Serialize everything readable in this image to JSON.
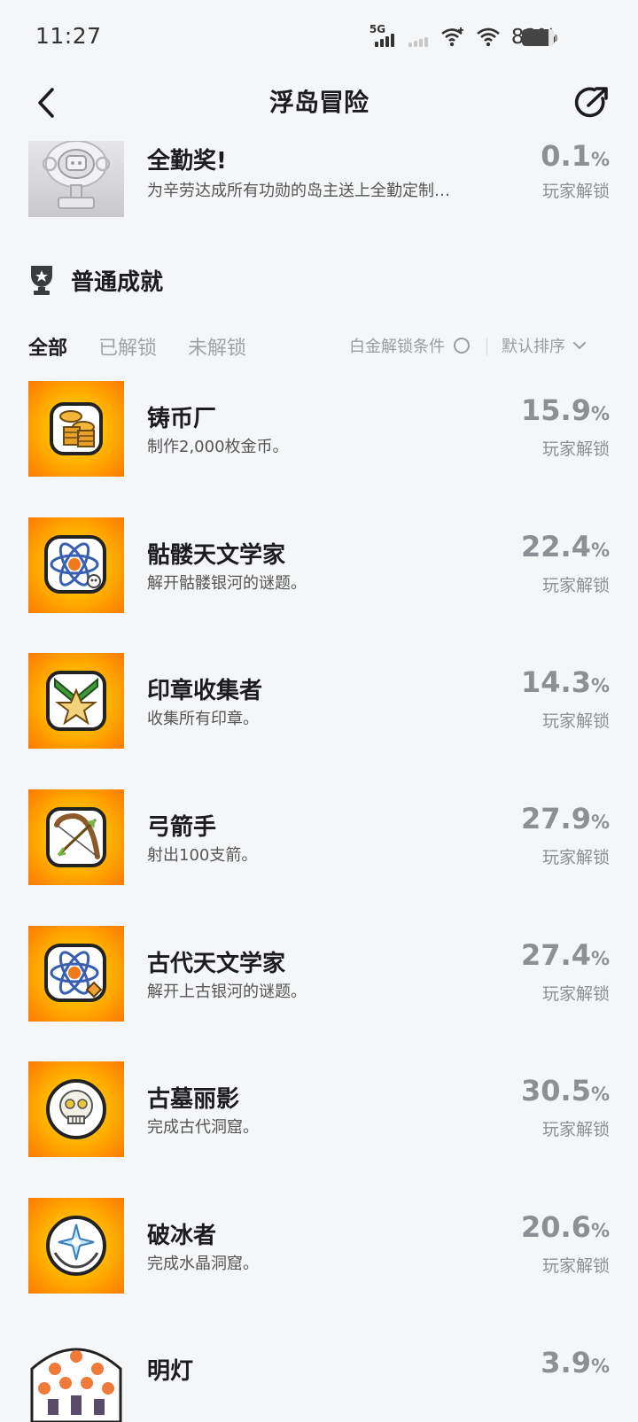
{
  "status_bar": {
    "time": "11:27",
    "network_label": "5G",
    "battery_percent": "83%",
    "battery_level": 0.83
  },
  "nav": {
    "title": "浮岛冒险"
  },
  "platinum_achievement": {
    "name": "全勤奖!",
    "description": "为辛劳达成所有功勋的岛主送上全勤定制…",
    "percent": "0.1",
    "percent_sign": "%",
    "unlock_label": "玩家解锁"
  },
  "section": {
    "title": "普通成就",
    "tabs": [
      "全部",
      "已解锁",
      "未解锁"
    ],
    "active_tab": "全部",
    "platinum_filter_label": "白金解锁条件",
    "sort_label": "默认排序"
  },
  "achievements": [
    {
      "name": "铸币厂",
      "description": "制作2,000枚金币。",
      "percent": "15.9",
      "percent_sign": "%",
      "unlock_label": "玩家解锁",
      "icon": "coins-icon"
    },
    {
      "name": "骷髅天文学家",
      "description": "解开骷髅银河的谜题。",
      "percent": "22.4",
      "percent_sign": "%",
      "unlock_label": "玩家解锁",
      "icon": "atom-skull-icon"
    },
    {
      "name": "印章收集者",
      "description": "收集所有印章。",
      "percent": "14.3",
      "percent_sign": "%",
      "unlock_label": "玩家解锁",
      "icon": "star-seal-icon"
    },
    {
      "name": "弓箭手",
      "description": "射出100支箭。",
      "percent": "27.9",
      "percent_sign": "%",
      "unlock_label": "玩家解锁",
      "icon": "bow-arrow-icon"
    },
    {
      "name": "古代天文学家",
      "description": "解开上古银河的谜题。",
      "percent": "27.4",
      "percent_sign": "%",
      "unlock_label": "玩家解锁",
      "icon": "atom-ancient-icon"
    },
    {
      "name": "古墓丽影",
      "description": "完成古代洞窟。",
      "percent": "30.5",
      "percent_sign": "%",
      "unlock_label": "玩家解锁",
      "icon": "skull-icon"
    },
    {
      "name": "破冰者",
      "description": "完成水晶洞窟。",
      "percent": "20.6",
      "percent_sign": "%",
      "unlock_label": "玩家解锁",
      "icon": "crystal-hands-icon"
    },
    {
      "name": "明灯",
      "description": "",
      "percent": "3.9",
      "percent_sign": "%",
      "unlock_label": "",
      "icon": "lantern-crowd-icon"
    }
  ]
}
